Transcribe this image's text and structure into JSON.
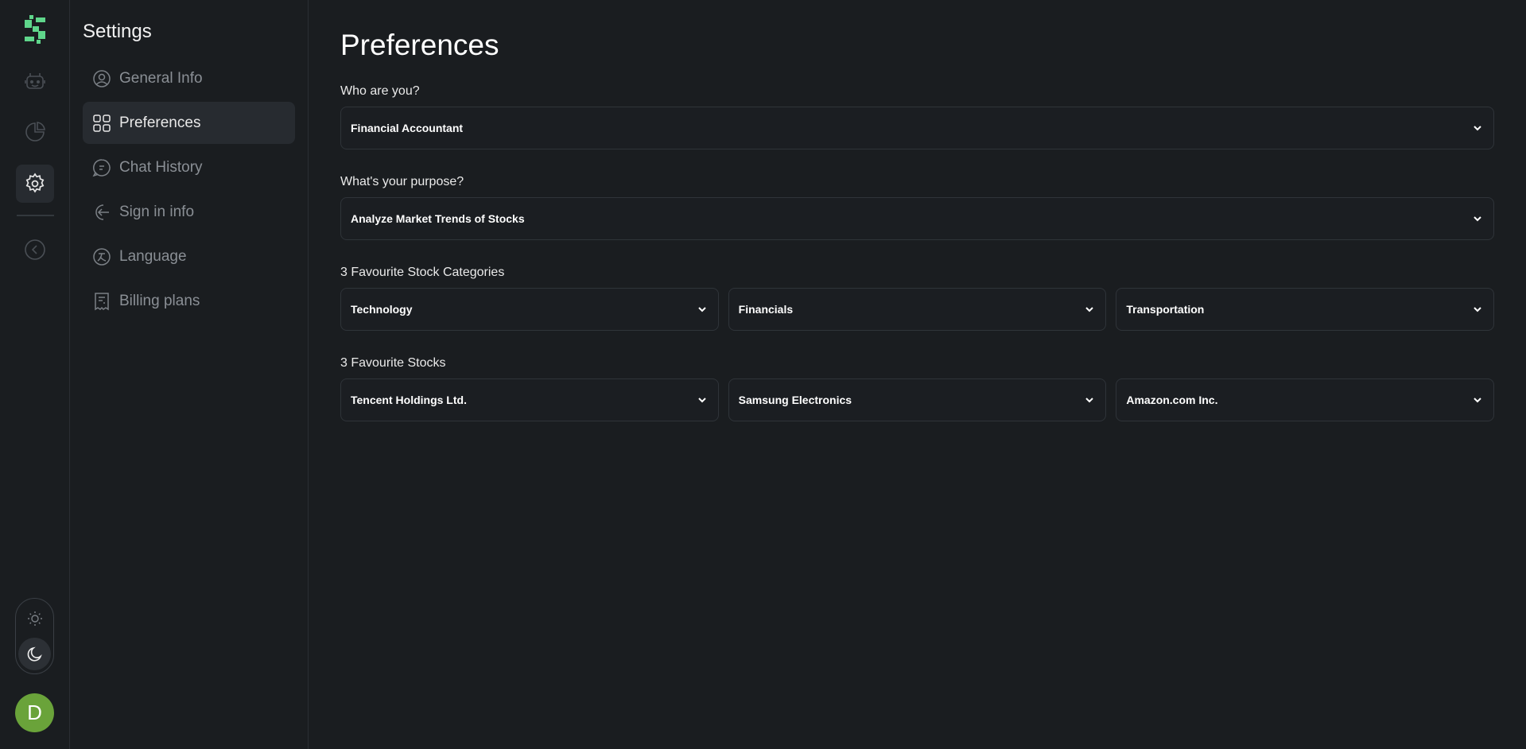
{
  "app": {
    "brand_color": "#5fd68b",
    "avatar_initial": "D",
    "avatar_color": "#6aa33a"
  },
  "rail": {
    "items": [
      {
        "icon": "robot-icon",
        "active": false
      },
      {
        "icon": "pie-chart-icon",
        "active": false
      },
      {
        "icon": "gear-icon",
        "active": true
      },
      {
        "icon": "collapse-left-icon",
        "active": false
      }
    ],
    "theme": {
      "light_icon": "sun-icon",
      "dark_icon": "moon-icon",
      "selected": "dark"
    }
  },
  "sidebar": {
    "title": "Settings",
    "items": [
      {
        "label": "General Info",
        "icon": "user-circle-icon",
        "active": false
      },
      {
        "label": "Preferences",
        "icon": "grid-icon",
        "active": true
      },
      {
        "label": "Chat History",
        "icon": "chat-icon",
        "active": false
      },
      {
        "label": "Sign in info",
        "icon": "sign-in-icon",
        "active": false
      },
      {
        "label": "Language",
        "icon": "translate-icon",
        "active": false
      },
      {
        "label": "Billing plans",
        "icon": "receipt-icon",
        "active": false
      }
    ]
  },
  "main": {
    "title": "Preferences",
    "who": {
      "label": "Who are you?",
      "value": "Financial Accountant"
    },
    "purpose": {
      "label": "What's your purpose?",
      "value": "Analyze Market Trends of Stocks"
    },
    "categories": {
      "label": "3 Favourite Stock Categories",
      "values": [
        "Technology",
        "Financials",
        "Transportation"
      ]
    },
    "stocks": {
      "label": "3 Favourite Stocks",
      "values": [
        "Tencent Holdings Ltd.",
        "Samsung Electronics",
        "Amazon.com Inc."
      ]
    }
  }
}
